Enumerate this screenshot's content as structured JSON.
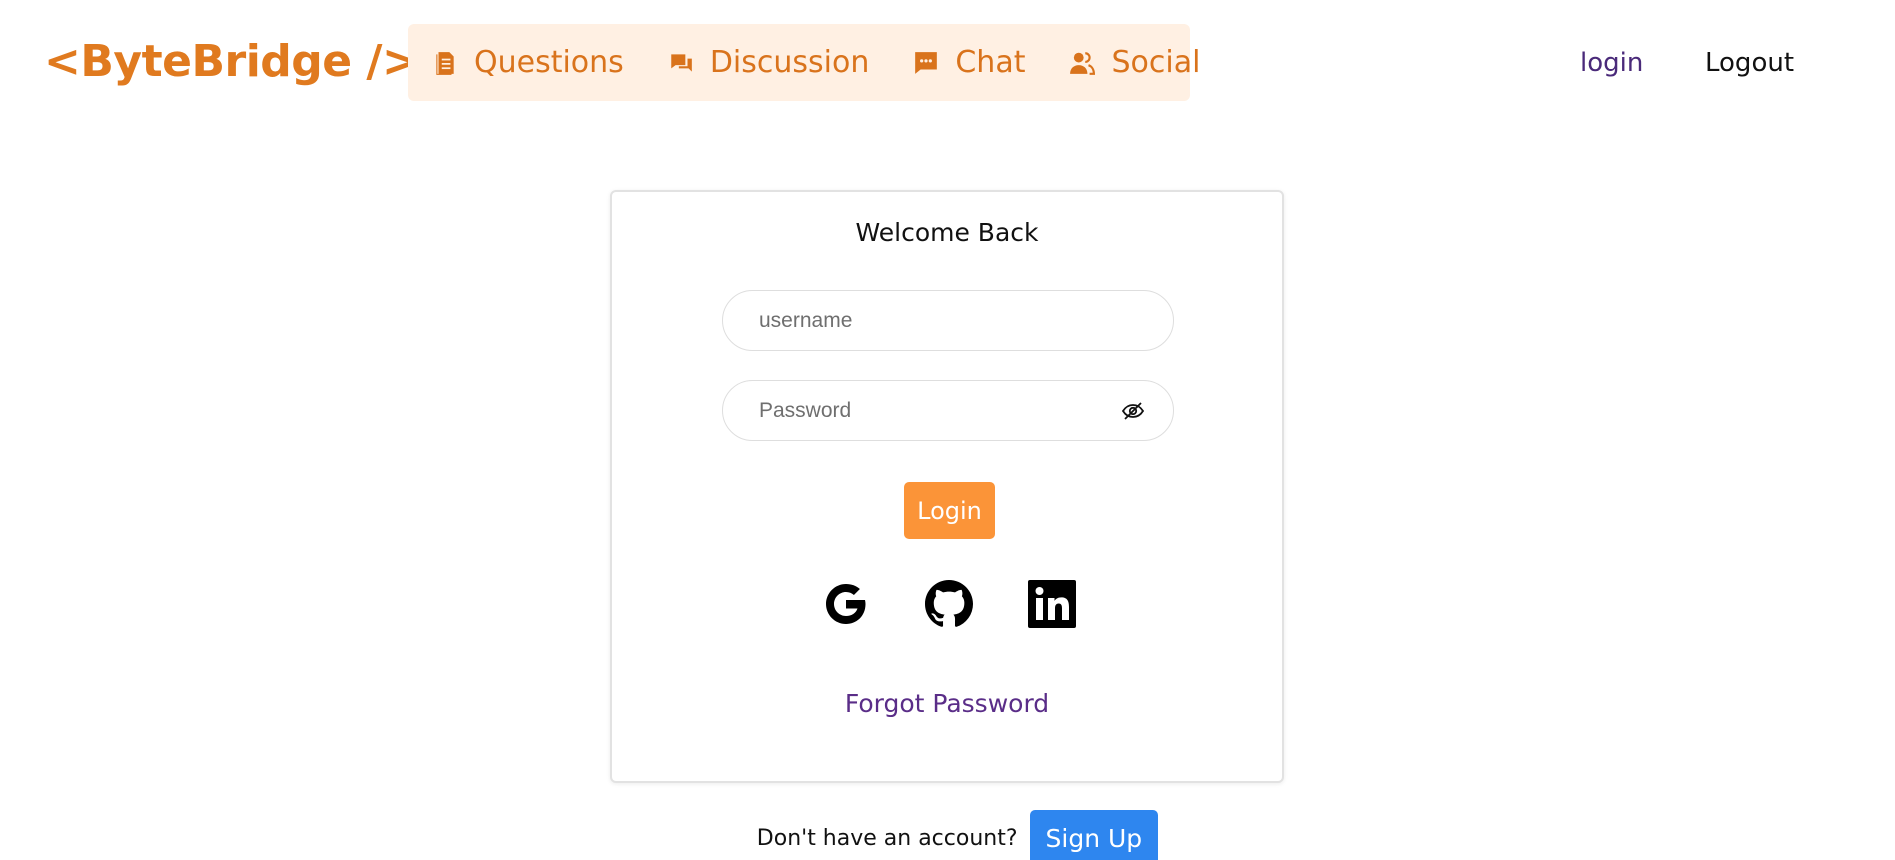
{
  "header": {
    "logo": "<ByteBridge />",
    "nav": [
      {
        "label": "Questions",
        "icon": "document-icon"
      },
      {
        "label": "Discussion",
        "icon": "comments-icon"
      },
      {
        "label": "Chat",
        "icon": "chat-icon"
      },
      {
        "label": "Social",
        "icon": "users-icon"
      }
    ],
    "login_label": "login",
    "logout_label": "Logout"
  },
  "card": {
    "title": "Welcome Back",
    "username_placeholder": "username",
    "password_placeholder": "Password",
    "login_button": "Login",
    "social_icons": [
      "google-icon",
      "github-icon",
      "linkedin-icon"
    ],
    "forgot_label": "Forgot Password"
  },
  "signup": {
    "prompt": "Don't have an account?",
    "button": "Sign Up"
  },
  "colors": {
    "brand_orange": "#e07a1f",
    "nav_bg": "#fff0e3",
    "login_button": "#fb9438",
    "signup_button": "#2e86ef",
    "link_purple": "#5a2d88"
  }
}
